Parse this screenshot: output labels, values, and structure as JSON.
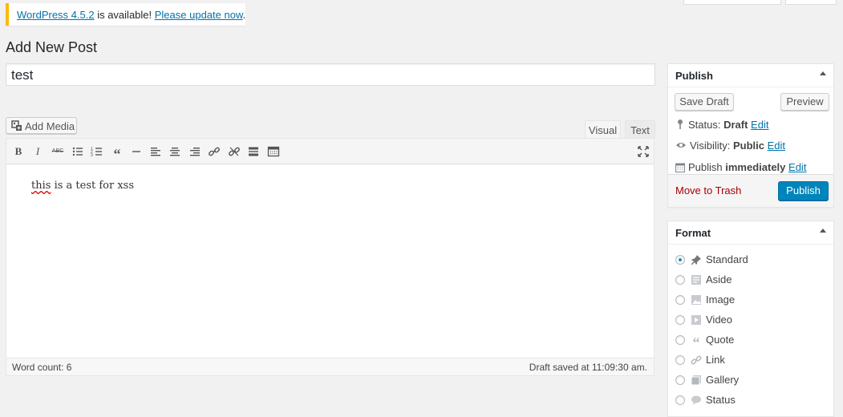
{
  "notice": {
    "link1": "WordPress 4.5.2",
    "middle": " is available! ",
    "link2": "Please update now",
    "end": "."
  },
  "page_title": "Add New Post",
  "post_title_value": "test",
  "editor": {
    "add_media_label": "Add Media",
    "tab_visual": "Visual",
    "tab_text": "Text",
    "content_word1": "this",
    "content_rest": " is a test for xss",
    "word_count": "Word count: 6",
    "draft_saved": "Draft saved at 11:09:30 am.",
    "toolbar_icons": [
      "bold-icon",
      "italic-icon",
      "strikethrough-icon",
      "bullet-list-icon",
      "numbered-list-icon",
      "blockquote-icon",
      "horizontal-rule-icon",
      "align-left-icon",
      "align-center-icon",
      "align-right-icon",
      "link-icon",
      "unlink-icon",
      "read-more-icon",
      "toolbar-toggle-icon",
      "fullscreen-icon"
    ]
  },
  "publish_box": {
    "title": "Publish",
    "save_draft": "Save Draft",
    "preview": "Preview",
    "status_label": "Status: ",
    "status_value": "Draft",
    "visibility_label": "Visibility: ",
    "visibility_value": "Public",
    "publish_label": "Publish ",
    "publish_value": "immediately",
    "edit": "Edit",
    "move_to_trash": "Move to Trash",
    "publish_button": "Publish"
  },
  "format_box": {
    "title": "Format",
    "selected": "Standard",
    "options": [
      {
        "label": "Standard",
        "icon": "pin-icon"
      },
      {
        "label": "Aside",
        "icon": "aside-icon"
      },
      {
        "label": "Image",
        "icon": "image-icon"
      },
      {
        "label": "Video",
        "icon": "video-icon"
      },
      {
        "label": "Quote",
        "icon": "quote-icon"
      },
      {
        "label": "Link",
        "icon": "link-icon"
      },
      {
        "label": "Gallery",
        "icon": "gallery-icon"
      },
      {
        "label": "Status",
        "icon": "status-icon"
      }
    ]
  },
  "colors": {
    "accent": "#0073aa",
    "publish_button": "#0085ba",
    "notice_border": "#ffb900",
    "trash": "#aa0000"
  }
}
